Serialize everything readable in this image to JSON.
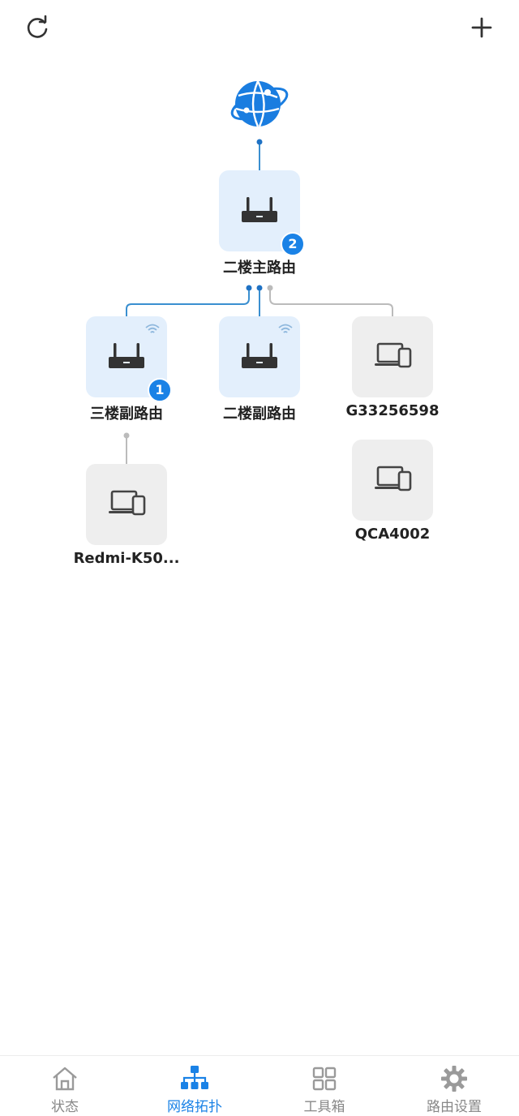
{
  "header": {
    "refresh_icon": "refresh-icon",
    "add_icon": "plus-icon"
  },
  "topology": {
    "internet_icon": "globe-icon",
    "main_router": {
      "label": "二楼主路由",
      "badge": "2"
    },
    "sub_routers": [
      {
        "label": "三楼副路由",
        "badge": "1",
        "wireless": true
      },
      {
        "label": "二楼副路由",
        "badge": "",
        "wireless": true
      }
    ],
    "devices": [
      {
        "label": "G33256598",
        "icon": "devices-icon"
      },
      {
        "label": "QCA4002",
        "icon": "devices-icon"
      },
      {
        "label": "Redmi-K50...",
        "icon": "devices-icon"
      }
    ],
    "colors": {
      "accent": "#1a82e6",
      "wired_line": "#3a8fd0",
      "inactive_line": "#bbbbbb"
    }
  },
  "nav": {
    "items": [
      {
        "label": "状态",
        "icon": "home-icon",
        "active": false
      },
      {
        "label": "网络拓扑",
        "icon": "topology-icon",
        "active": true
      },
      {
        "label": "工具箱",
        "icon": "grid-icon",
        "active": false
      },
      {
        "label": "路由设置",
        "icon": "gear-icon",
        "active": false
      }
    ]
  }
}
